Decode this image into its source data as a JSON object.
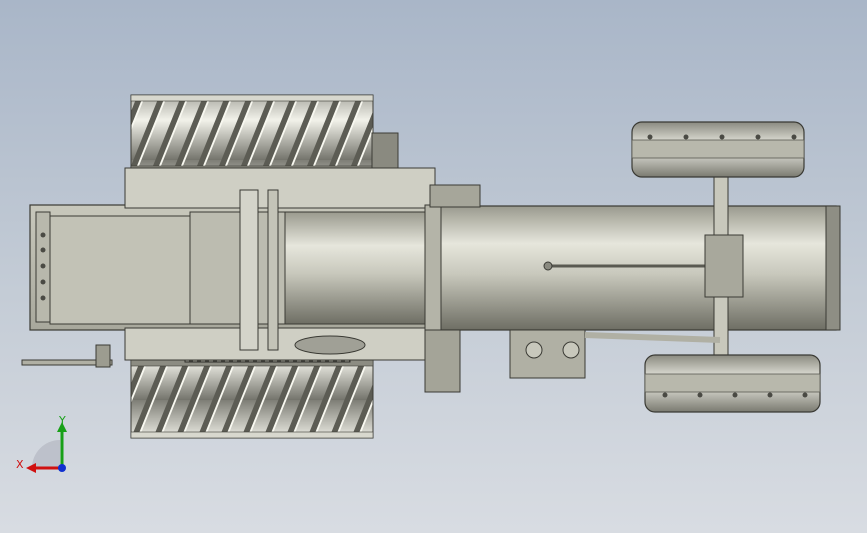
{
  "viewport": {
    "background_top": "#a9b6c8",
    "background_bottom": "#d8dce2"
  },
  "model": {
    "description_icon": "traction-engine-top-view"
  },
  "triad": {
    "x_label": "X",
    "y_label": "Y",
    "x_color": "#d01010",
    "y_color": "#18a018",
    "z_color": "#1030d0"
  }
}
